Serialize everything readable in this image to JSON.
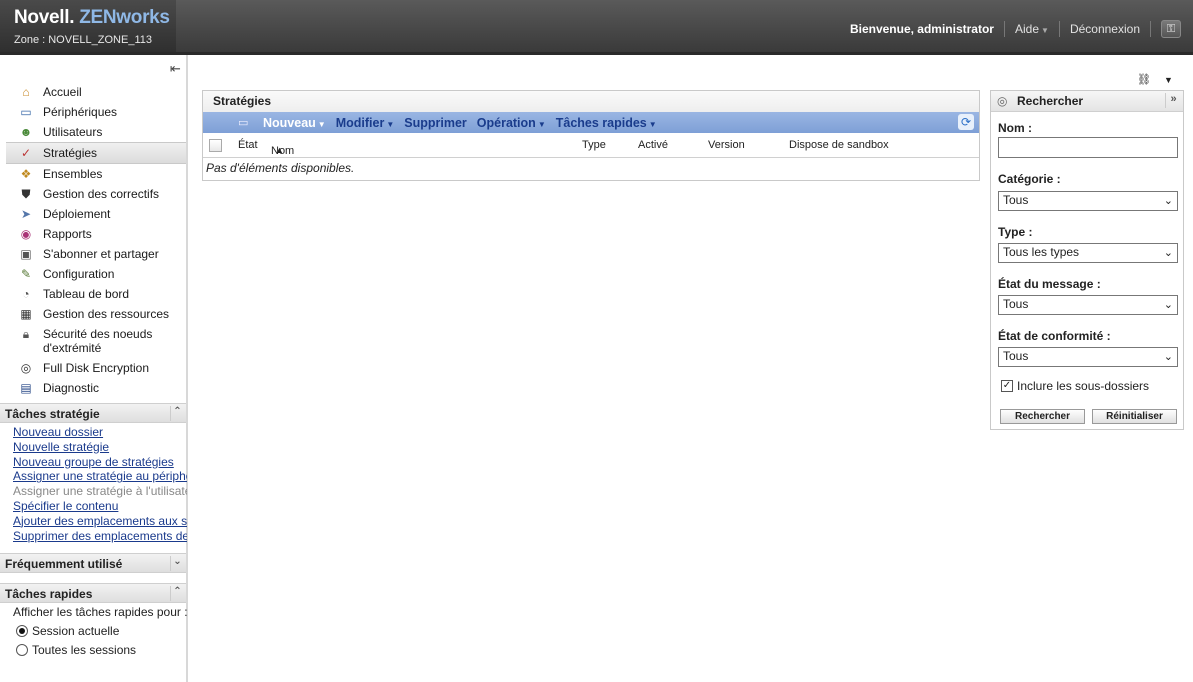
{
  "header": {
    "brand_part1": "Novell.",
    "brand_part2": "ZENworks",
    "zone": "Zone : NOVELL_ZONE_113",
    "welcome": "Bienvenue, administrator",
    "help": "Aide",
    "logout": "Déconnexion"
  },
  "nav": {
    "items": [
      {
        "label": "Accueil",
        "icon": "home-icon"
      },
      {
        "label": "Périphériques",
        "icon": "monitor-icon"
      },
      {
        "label": "Utilisateurs",
        "icon": "users-icon"
      },
      {
        "label": "Stratégies",
        "icon": "policy-icon",
        "active": true
      },
      {
        "label": "Ensembles",
        "icon": "bundles-icon"
      },
      {
        "label": "Gestion des correctifs",
        "icon": "shield-icon"
      },
      {
        "label": "Déploiement",
        "icon": "deploy-icon"
      },
      {
        "label": "Rapports",
        "icon": "reports-icon"
      },
      {
        "label": "S'abonner et partager",
        "icon": "subscribe-icon"
      },
      {
        "label": "Configuration",
        "icon": "wrench-icon"
      },
      {
        "label": "Tableau de bord",
        "icon": "dashboard-icon"
      },
      {
        "label": "Gestion des ressources",
        "icon": "assets-icon"
      },
      {
        "label": "Sécurité des noeuds d'extrémité",
        "icon": "lock-icon"
      },
      {
        "label": "Full Disk Encryption",
        "icon": "disk-icon"
      },
      {
        "label": "Diagnostic",
        "icon": "diagnostic-icon"
      }
    ]
  },
  "policy_tasks": {
    "title": "Tâches stratégie",
    "items": [
      {
        "label": "Nouveau dossier",
        "enabled": true
      },
      {
        "label": "Nouvelle stratégie",
        "enabled": true
      },
      {
        "label": "Nouveau groupe de stratégies",
        "enabled": true
      },
      {
        "label": "Assigner une stratégie au périphérique",
        "enabled": true
      },
      {
        "label": "Assigner une stratégie à l'utilisateur",
        "enabled": false
      },
      {
        "label": "Spécifier le contenu",
        "enabled": true
      },
      {
        "label": "Ajouter des emplacements aux stratégies",
        "enabled": true
      },
      {
        "label": "Supprimer des emplacements des stratégies",
        "enabled": true
      }
    ]
  },
  "frequent": {
    "title": "Fréquemment utilisé"
  },
  "quick_tasks": {
    "title": "Tâches rapides",
    "text": "Afficher les tâches rapides pour :",
    "opt_current": "Session actuelle",
    "opt_all": "Toutes les sessions",
    "selected": "current"
  },
  "main": {
    "title": "Stratégies",
    "toolbar": {
      "new": "Nouveau",
      "edit": "Modifier",
      "delete": "Supprimer",
      "action": "Opération",
      "quick": "Tâches rapides"
    },
    "columns": {
      "state": "État",
      "name": "Nom",
      "type": "Type",
      "enabled": "Activé",
      "version": "Version",
      "sandbox": "Dispose de sandbox"
    },
    "empty": "Pas d'éléments disponibles."
  },
  "search": {
    "title": "Rechercher",
    "name_label": "Nom :",
    "name_value": "",
    "category_label": "Catégorie :",
    "category_value": "Tous",
    "type_label": "Type :",
    "type_value": "Tous les types",
    "msg_label": "État du message :",
    "msg_value": "Tous",
    "compliance_label": "État de conformité :",
    "compliance_value": "Tous",
    "include_sub": "Inclure les sous-dossiers",
    "include_checked": true,
    "search_btn": "Rechercher",
    "reset_btn": "Réinitialiser"
  }
}
